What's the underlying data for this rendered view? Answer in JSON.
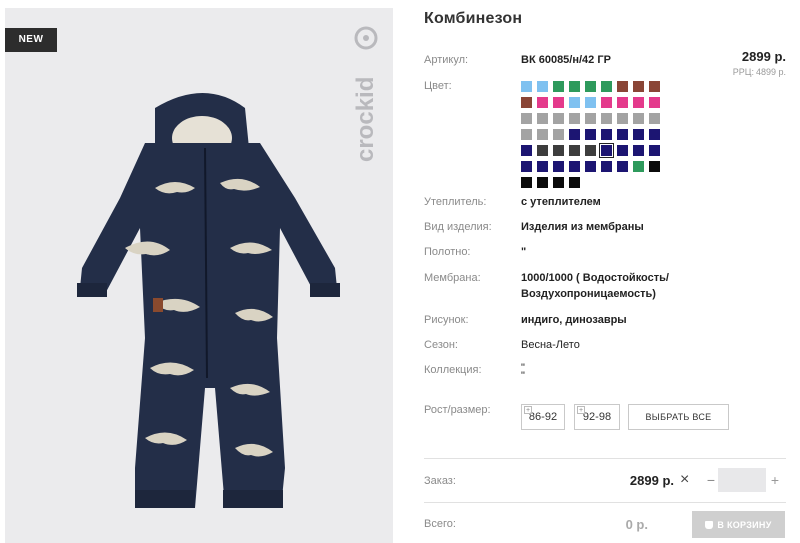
{
  "badge": "NEW",
  "brand": {
    "logo_text": "crockid"
  },
  "product": {
    "title": "Комбинезон",
    "article_label": "Артикул:",
    "article": "ВК 60085/н/42 ГР",
    "price": "2899 р.",
    "rrp_label": "РРЦ:",
    "rrp": "4899 р.",
    "color_label": "Цвет:",
    "colors": [
      "#7fc1f0",
      "#7fc1f0",
      "#2e9a5c",
      "#2e9a5c",
      "#2e9a5c",
      "#2e9a5c",
      "#8a4536",
      "#8a4536",
      "#8a4536",
      "#8a4536",
      "#e43a8c",
      "#e43a8c",
      "#7fc1f0",
      "#7fc1f0",
      "#e43a8c",
      "#e43a8c",
      "#e43a8c",
      "#e43a8c",
      "#a3a3a3",
      "#a3a3a3",
      "#a3a3a3",
      "#a3a3a3",
      "#a3a3a3",
      "#a3a3a3",
      "#a3a3a3",
      "#a3a3a3",
      "#a3a3a3",
      "#a3a3a3",
      "#a3a3a3",
      "#a3a3a3",
      "#1c1572",
      "#1c1572",
      "#1c1572",
      "#1c1572",
      "#1c1572",
      "#1c1572",
      "#1c1572",
      "#3d3d3d",
      "#3d3d3d",
      "#3d3d3d",
      "#3d3d3d",
      "#1c1572",
      "#1c1572",
      "#1c1572",
      "#1c1572",
      "#1c1572",
      "#1c1572",
      "#1c1572",
      "#1c1572",
      "#1c1572",
      "#1c1572",
      "#1c1572",
      "#2e9a5c",
      "#0b0b0b",
      "#0b0b0b",
      "#0b0b0b",
      "#0b0b0b",
      "#0b0b0b"
    ],
    "selected_color_index": 41,
    "attributes": [
      {
        "label": "Утеплитель:",
        "value": "с утеплителем"
      },
      {
        "label": "Вид изделия:",
        "value": "Изделия из мембраны"
      },
      {
        "label": "Полотно:",
        "value": "\""
      },
      {
        "label": "Мембрана:",
        "value": "1000/1000 ( Водостойкость/",
        "value2": "Воздухопроницаемость)"
      },
      {
        "label": "Рисунок:",
        "value": "индиго, динозавры"
      },
      {
        "label": "Сезон:",
        "value": "Весна-Лето"
      },
      {
        "label": "Коллекция:",
        "value": "\"",
        "value2": "\""
      }
    ],
    "size_label": "Рост/размер:",
    "sizes": [
      "86-92",
      "92-98"
    ],
    "select_all": "ВЫБРАТЬ ВСЕ"
  },
  "order": {
    "label": "Заказ:",
    "total": "2899 р.",
    "times": "×",
    "minus": "−",
    "plus": "+",
    "qty": ""
  },
  "summary": {
    "label": "Всего:",
    "sum": "0 р.",
    "cart_button": "В КОРЗИНУ"
  }
}
